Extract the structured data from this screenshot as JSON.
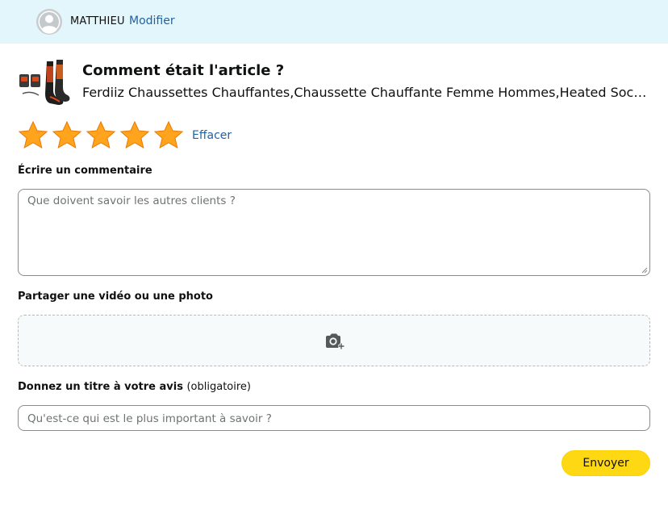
{
  "header": {
    "username": "MATTHIEU",
    "modify_label": "Modifier"
  },
  "product": {
    "question": "Comment était l'article ?",
    "title": "Ferdiiz Chaussettes Chauffantes,Chaussette Chauffante Femme Hommes,Heated Socks avec Ba…"
  },
  "rating": {
    "stars_filled": 5,
    "stars_total": 5,
    "star_color": "#ffa41c",
    "clear_label": "Effacer"
  },
  "review": {
    "label": "Écrire un commentaire",
    "placeholder": "Que doivent savoir les autres clients ?",
    "value": ""
  },
  "media": {
    "label": "Partager une vidéo ou une photo",
    "icon": "camera-add-icon"
  },
  "headline": {
    "label": "Donnez un titre à votre avis",
    "label_suffix": "(obligatoire)",
    "placeholder": "Qu'est-ce qui est le plus important à savoir ?",
    "value": ""
  },
  "submit": {
    "label": "Envoyer",
    "color": "#ffd814"
  },
  "colors": {
    "header_bg": "#e3f6fc",
    "link": "#2162a1"
  }
}
